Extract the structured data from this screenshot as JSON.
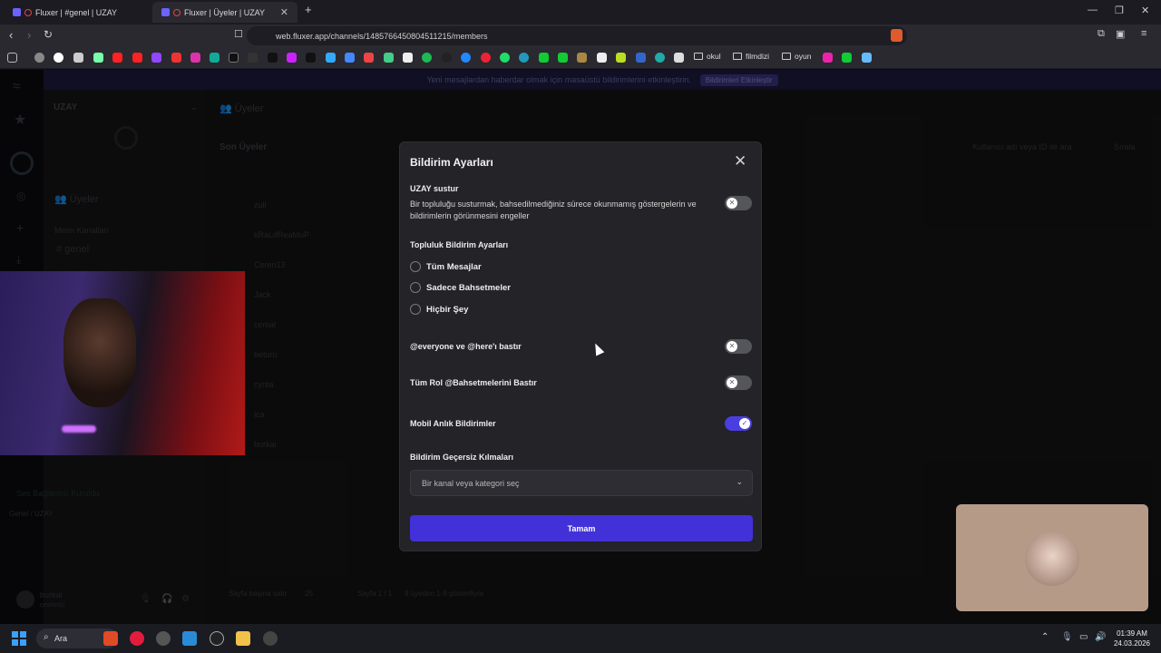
{
  "browser": {
    "tabs": [
      {
        "title": "Fluxer | #genel | UZAY",
        "active": false
      },
      {
        "title": "Fluxer | Üyeler | UZAY",
        "active": true
      }
    ],
    "url": "web.fluxer.app/channels/1485766450804511215/members",
    "bookmark_folders": [
      "okul",
      "filmdizi",
      "oyun"
    ]
  },
  "app": {
    "banner_text": "Yeni mesajlardan haberdar olmak için masaüstü bildirimlerini etkinleştirin.",
    "banner_button": "Bildirimleri Etkinleştir",
    "server_name": "UZAY",
    "sidebar_members": "Üyeler",
    "sidebar_category": "Metin Kanalları",
    "sidebar_channel": "genel",
    "header_title": "Üyeler",
    "section_title": "Son Üyeler",
    "members": [
      "zuli",
      "kRaLdReaMuP",
      "Ceren13",
      "Jack",
      "cemal",
      "beturu",
      "cyrita",
      "ica",
      "burkai"
    ],
    "voice_status": "Ses Bağlantısı Kuruldu",
    "voice_channel": "Genel / UZAY",
    "footer_user": "burkai",
    "footer_user_status": "çevrimiçi",
    "pagination_label": "Sayfa başına satır",
    "pagination_size": "25",
    "pagination_page": "Sayfa 1 / 1",
    "pagination_count": "9 üyeden 1-9 gösteriliyor",
    "search_placeholder": "Kullanıcı adı veya ID ile ara",
    "sort_label": "Sırala"
  },
  "modal": {
    "title": "Bildirim Ayarları",
    "mute": {
      "label": "UZAY sustur",
      "description": "Bir topluluğu susturmak, bahsedilmediğiniz sürece okunmamış göstergelerin ve bildirimlerin görünmesini engeller",
      "enabled": false
    },
    "community_section": "Topluluk Bildirim Ayarları",
    "options": [
      "Tüm Mesajlar",
      "Sadece Bahsetmeler",
      "Hiçbir Şey"
    ],
    "suppress_everyone": {
      "label": "@everyone ve @here'ı bastır",
      "enabled": false
    },
    "suppress_roles": {
      "label": "Tüm Rol @Bahsetmelerini Bastır",
      "enabled": false
    },
    "mobile_push": {
      "label": "Mobil Anlık Bildirimler",
      "enabled": true
    },
    "overrides_label": "Bildirim Geçersiz Kılmaları",
    "overrides_placeholder": "Bir kanal veya kategori seç",
    "ok_button": "Tamam"
  },
  "taskbar": {
    "search_label": "Ara",
    "time": "01:39 AM",
    "date": "24.03.2026"
  },
  "colors": {
    "accent": "#4231d8",
    "modal_bg": "#232328"
  }
}
